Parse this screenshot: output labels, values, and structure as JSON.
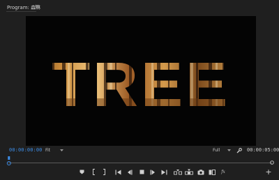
{
  "panel": {
    "title": "Program: 森林"
  },
  "video": {
    "overlay_text": "TREE",
    "colors": {
      "background": "#040404",
      "forest_light": "#f0c070",
      "forest_mid": "#b46d2c",
      "forest_dark": "#3b220f"
    }
  },
  "controls": {
    "current_timecode": "00:00:00:00",
    "zoom_value": "Fit",
    "resolution_value": "Full",
    "duration_timecode": "00:00:05:00",
    "fx_label": "fx",
    "add_label": "+",
    "timecode_color": "#3d8ee8"
  },
  "icons": [
    "menu-icon",
    "chevron-down-icon",
    "wrench-icon",
    "marker-icon",
    "mark-in-icon",
    "mark-out-icon",
    "go-to-in-icon",
    "step-back-icon",
    "stop-icon",
    "play-icon",
    "step-forward-icon",
    "go-to-out-icon",
    "insert-icon",
    "overwrite-icon",
    "export-frame-icon",
    "comparison-icon",
    "fx-icon",
    "plus-icon"
  ]
}
